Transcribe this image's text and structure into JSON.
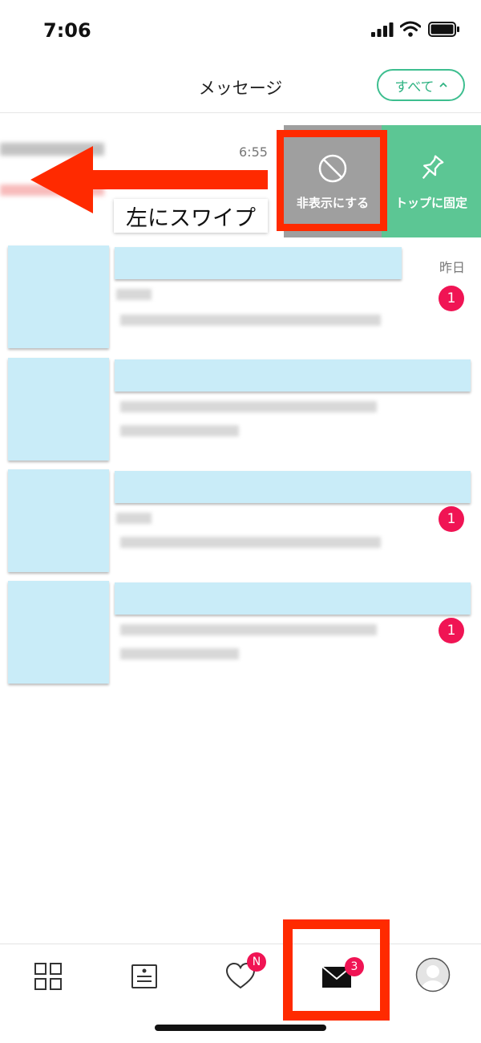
{
  "status_bar": {
    "time": "7:06"
  },
  "header": {
    "title": "メッセージ",
    "filter_label": "すべて"
  },
  "swiped_item": {
    "time": "6:55",
    "actions": {
      "hide_label": "非表示にする",
      "pin_label": "トップに固定"
    }
  },
  "annotation": {
    "caption": "左にスワイプ"
  },
  "messages": [
    {
      "time": "昨日",
      "unread": "1"
    },
    {},
    {
      "unread": "1"
    },
    {
      "unread": "1"
    }
  ],
  "tab_bar": {
    "likes_badge": "N",
    "messages_badge": "3"
  },
  "colors": {
    "accent": "#3dbe8f",
    "pin_action": "#5cc694",
    "hide_action": "#9f9f9f",
    "badge": "#f01454",
    "annotation": "#ff2a00",
    "placeholder": "#c9ecf8"
  }
}
